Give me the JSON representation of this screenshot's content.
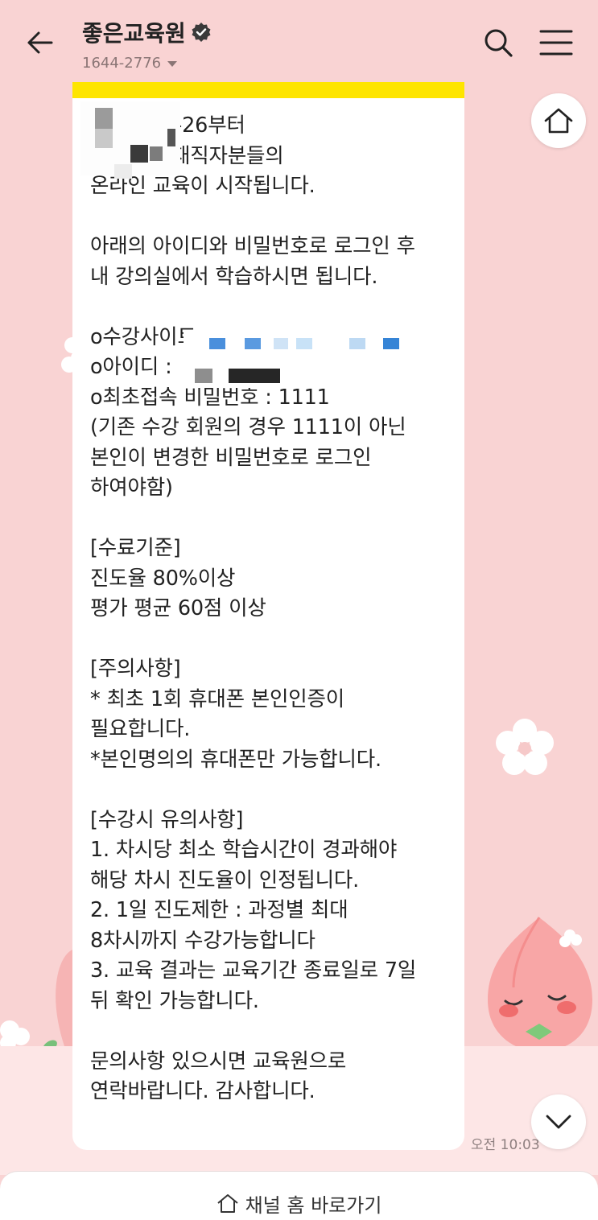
{
  "header": {
    "back_icon": "arrow-left-icon",
    "channel_name": "좋은교육원",
    "verified_icon": "verified-badge-icon",
    "phone": "1644-2776",
    "search_icon": "search-icon",
    "menu_icon": "hamburger-menu-icon"
  },
  "message": {
    "text": "2024-03-26부터\n어린이집 재직자분들의\n온라인 교육이 시작됩니다.\n\n아래의 아이디와 비밀번호로 로그인 후\n내 강의실에서 학습하시면 됩니다.\n\no수강사이트 :\no아이디 :\no최초접속 비밀번호 : 1111\n(기존 수강 회원의 경우 1111이 아닌\n본인이 변경한 비밀번호로 로그인\n하여야함)\n\n[수료기준]\n진도율 80%이상\n평가 평균 60점 이상\n\n[주의사항]\n* 최초 1회 휴대폰 본인인증이\n필요합니다.\n*본인명의의 휴대폰만 가능합니다.\n\n[수강시 유의사항]\n1. 차시당 최소 학습시간이 경과해야\n해당 차시 진도율이 인정됩니다.\n2. 1일 진도제한 : 과정별 최대\n8차시까지 수강가능합니다\n3. 교육 결과는 교육기간 종료일로 7일\n뒤 확인 가능합니다.\n\n문의사항 있으시면 교육원으로\n연락바랍니다. 감사합니다.",
    "time": "오전 10:03"
  },
  "buttons": {
    "home_icon": "home-icon",
    "scroll_down_icon": "chevron-down-icon"
  },
  "bottom": {
    "shortcut_icon": "home-icon",
    "shortcut_label": "채널 홈 바로가기"
  },
  "colors": {
    "background": "#f9d3d3",
    "card_accent": "#fee500",
    "card": "#ffffff"
  }
}
